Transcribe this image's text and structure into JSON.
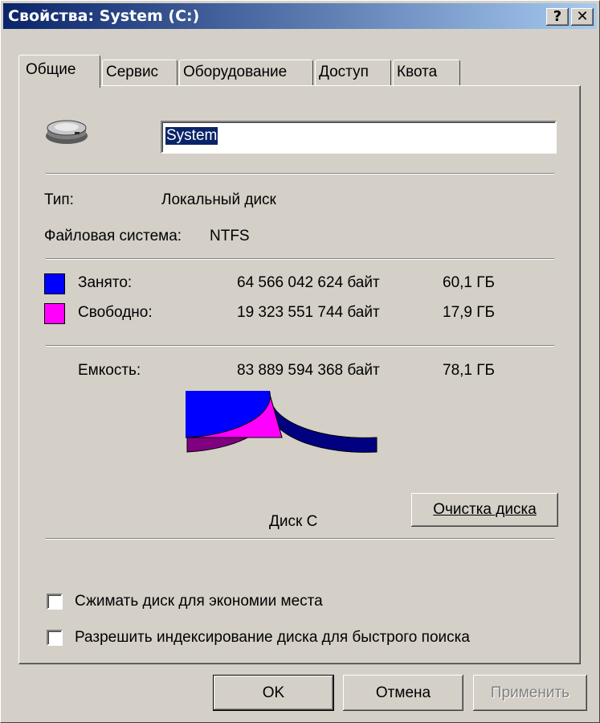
{
  "window": {
    "title": "Свойства: System (C:)",
    "help_label": "?",
    "close_label": "✕"
  },
  "tabs": [
    {
      "label": "Общие",
      "active": true
    },
    {
      "label": "Сервис"
    },
    {
      "label": "Оборудование"
    },
    {
      "label": "Доступ"
    },
    {
      "label": "Квота"
    }
  ],
  "general": {
    "drive_icon": "hard-drive-icon",
    "volume_name": "System",
    "type_label": "Тип:",
    "type_value": "Локальный диск",
    "fs_label": "Файловая система:",
    "fs_value": "NTFS",
    "used": {
      "label": "Занято:",
      "bytes": "64 566 042 624 байт",
      "size": "60,1 ГБ",
      "color": "#0000ff"
    },
    "free": {
      "label": "Свободно:",
      "bytes": "19 323 551 744 байт",
      "size": "17,9 ГБ",
      "color": "#ff00ff"
    },
    "capacity": {
      "label": "Емкость:",
      "bytes": "83 889 594 368 байт",
      "size": "78,1 ГБ"
    },
    "pie_used_fraction": 0.7697,
    "disk_label": "Диск C",
    "cleanup_button": "Очистка диска",
    "compress_label": "Сжимать диск для экономии места",
    "index_label": "Разрешить индексирование диска для быстрого поиска"
  },
  "footer": {
    "ok": "OK",
    "cancel": "Отмена",
    "apply": "Применить"
  }
}
